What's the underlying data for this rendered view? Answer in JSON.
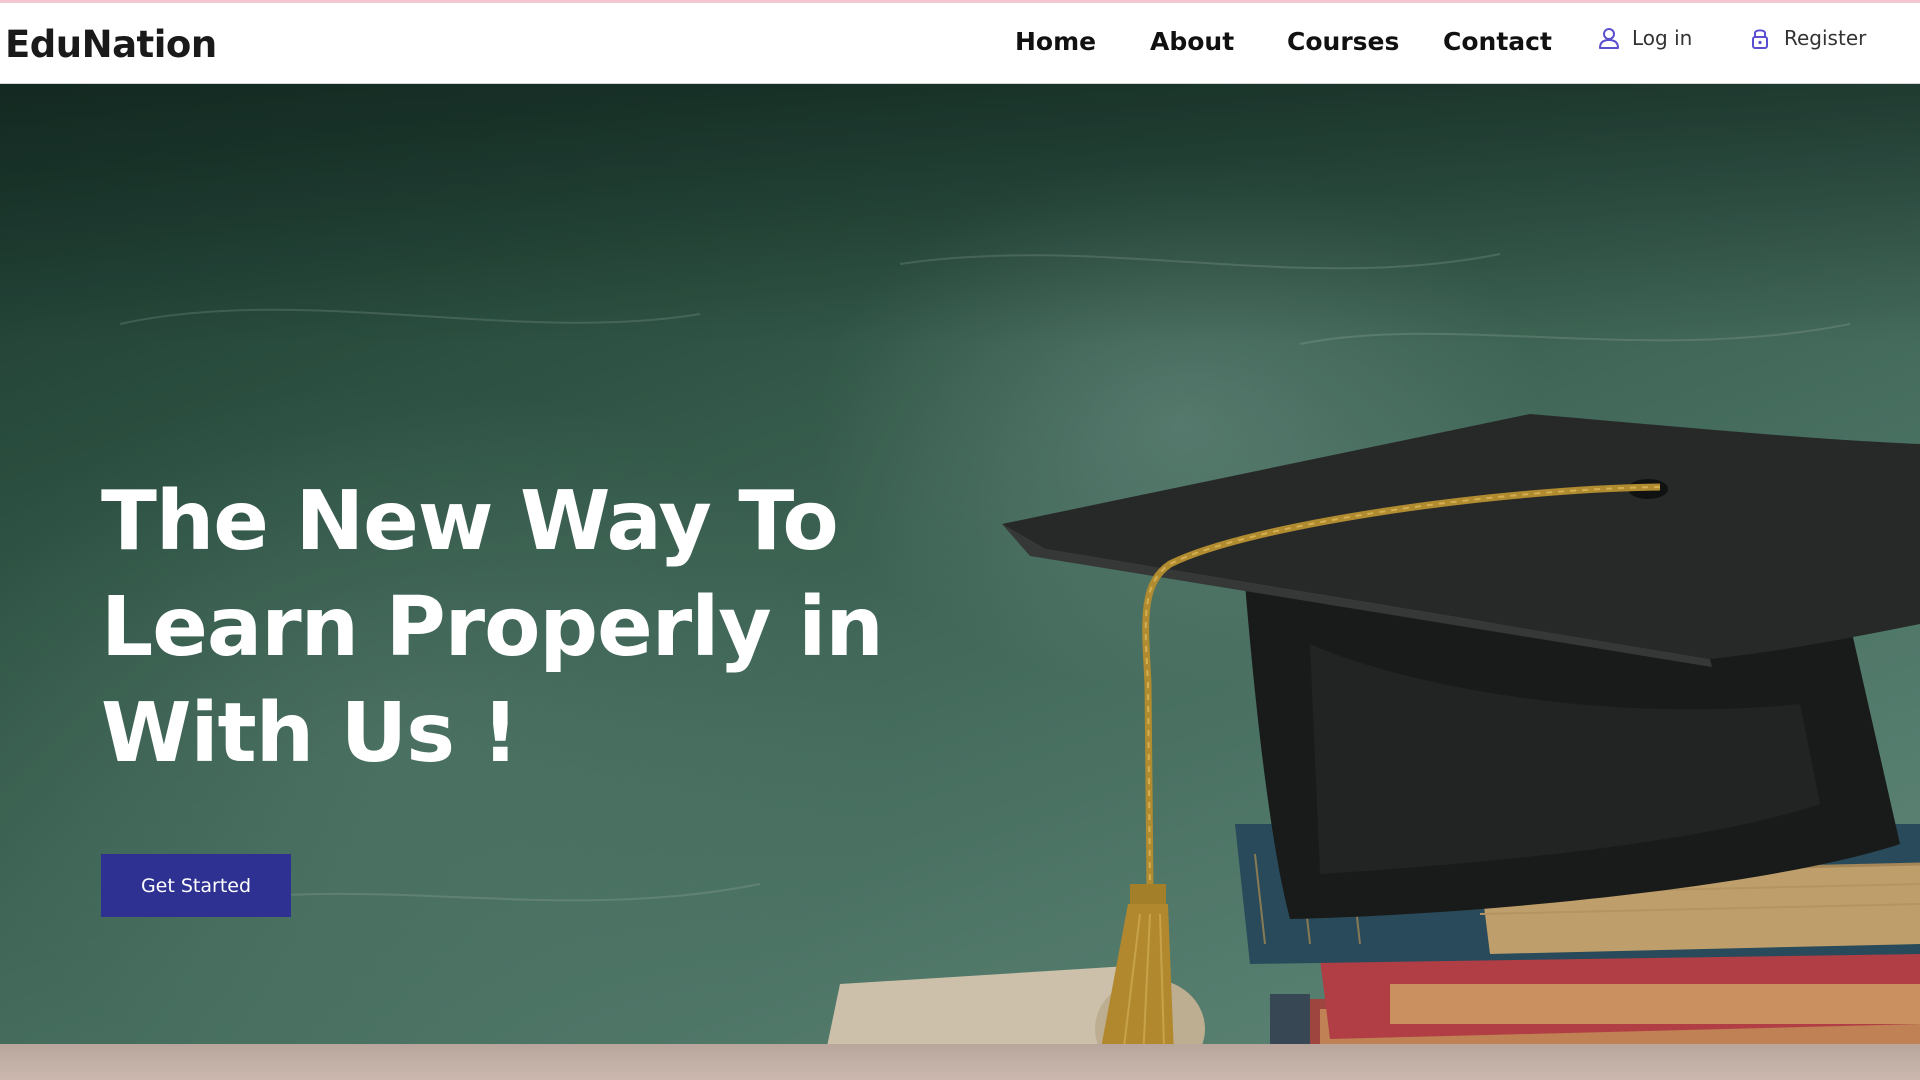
{
  "brand": {
    "name": "EduNation"
  },
  "nav": {
    "links": [
      {
        "label": "Home"
      },
      {
        "label": "About"
      },
      {
        "label": "Courses"
      },
      {
        "label": "Contact"
      }
    ],
    "login": {
      "label": "Log in",
      "icon": "user-icon"
    },
    "register": {
      "label": "Register",
      "icon": "lock-icon"
    }
  },
  "hero": {
    "headline_lines": [
      "The New Way To",
      "Learn Properly in",
      "With Us !"
    ],
    "cta_label": "Get Started",
    "background_image": "chalkboard-graduation-cap-books"
  },
  "colors": {
    "accent": "#2e3192",
    "auth_icon": "#5a4fcf",
    "nav_text": "#111111"
  }
}
